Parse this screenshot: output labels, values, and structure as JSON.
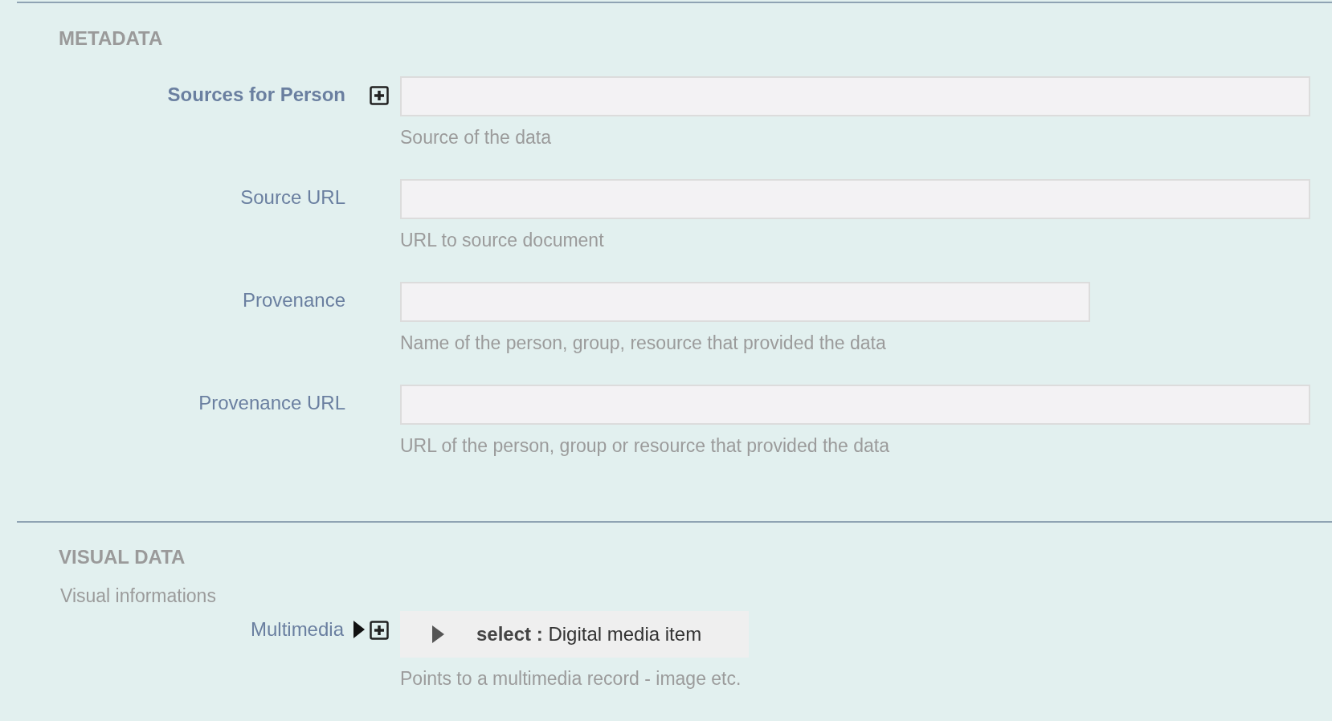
{
  "sections": [
    {
      "title": "METADATA",
      "fields": [
        {
          "kind": "text",
          "label": "Sources for Person",
          "emphasized": true,
          "repeatable": true,
          "hint": "Source of the data"
        },
        {
          "kind": "text",
          "label": "Source URL",
          "emphasized": false,
          "repeatable": false,
          "hint": "URL to source document"
        },
        {
          "kind": "short-text",
          "label": "Provenance",
          "emphasized": false,
          "repeatable": false,
          "hint": "Name of the person, group, resource that provided the data"
        },
        {
          "kind": "text",
          "label": "Provenance URL",
          "emphasized": false,
          "repeatable": false,
          "hint": "URL of the person, group or resource that provided the data"
        }
      ]
    },
    {
      "title": "VISUAL DATA",
      "description": "Visual informations",
      "fields": [
        {
          "kind": "select",
          "label": "Multimedia",
          "emphasized": false,
          "repeatable": true,
          "select_label": "select :",
          "value": "Digital media item",
          "hint": "Points to a multimedia record - image etc."
        }
      ]
    }
  ]
}
